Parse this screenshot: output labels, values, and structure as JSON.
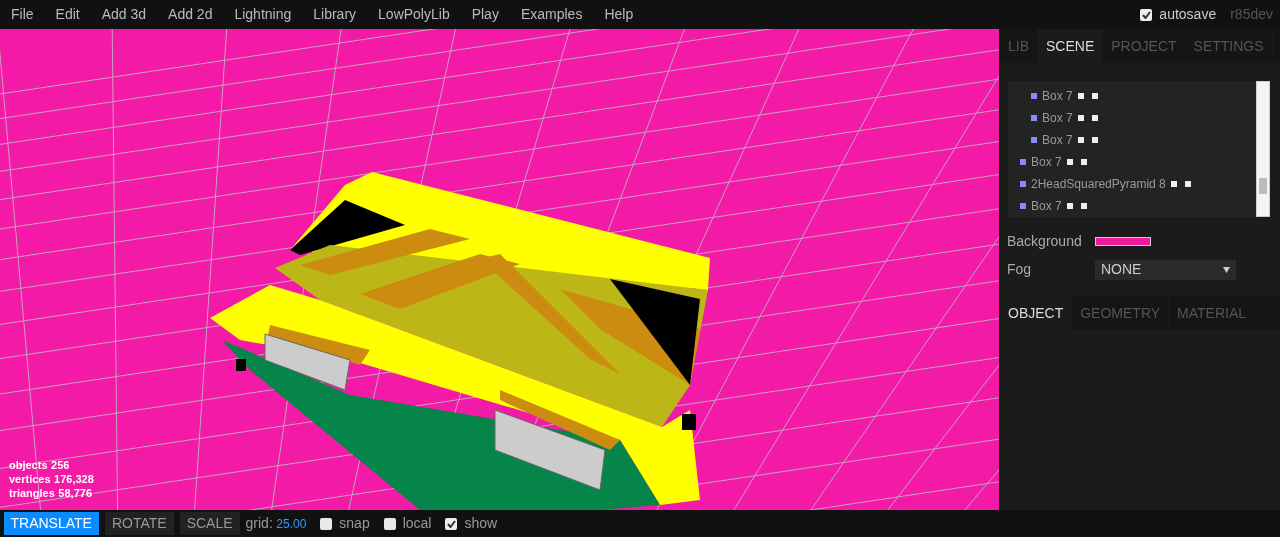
{
  "menu": [
    "File",
    "Edit",
    "Add 3d",
    "Add 2d",
    "Lightning",
    "Library",
    "LowPolyLib",
    "Play",
    "Examples",
    "Help"
  ],
  "autosave": {
    "label": "autosave",
    "checked": true
  },
  "version": "r85dev",
  "stats": [
    {
      "label": "objects",
      "value": "256"
    },
    {
      "label": "vertices",
      "value": "176,328"
    },
    {
      "label": "triangles",
      "value": "58,776"
    }
  ],
  "toolbar": {
    "modes": [
      {
        "label": "TRANSLATE",
        "selected": true
      },
      {
        "label": "ROTATE",
        "selected": false
      },
      {
        "label": "SCALE",
        "selected": false
      }
    ],
    "grid_label": "grid:",
    "grid_value": "25.00",
    "options": [
      {
        "label": "snap",
        "checked": false
      },
      {
        "label": "local",
        "checked": false
      },
      {
        "label": "show",
        "checked": true
      }
    ]
  },
  "sidebar_tabs": [
    {
      "label": "LIB",
      "selected": false
    },
    {
      "label": "SCENE",
      "selected": true
    },
    {
      "label": "PROJECT",
      "selected": false
    },
    {
      "label": "SETTINGS",
      "selected": false
    }
  ],
  "outliner": [
    {
      "children": [
        {
          "label": "Box 7"
        },
        {
          "label": "Box 7"
        },
        {
          "label": "Box 7"
        }
      ]
    },
    {
      "label": "Box 7"
    },
    {
      "label": "2HeadSquaredPyramid 8"
    },
    {
      "label": "Box 7"
    }
  ],
  "background": {
    "label": "Background",
    "color": "#ee1c9c"
  },
  "fog": {
    "label": "Fog",
    "value": "NONE"
  },
  "properties_tabs": [
    {
      "label": "OBJECT",
      "selected": true
    },
    {
      "label": "GEOMETRY",
      "selected": false
    },
    {
      "label": "MATERIAL",
      "selected": false
    }
  ]
}
